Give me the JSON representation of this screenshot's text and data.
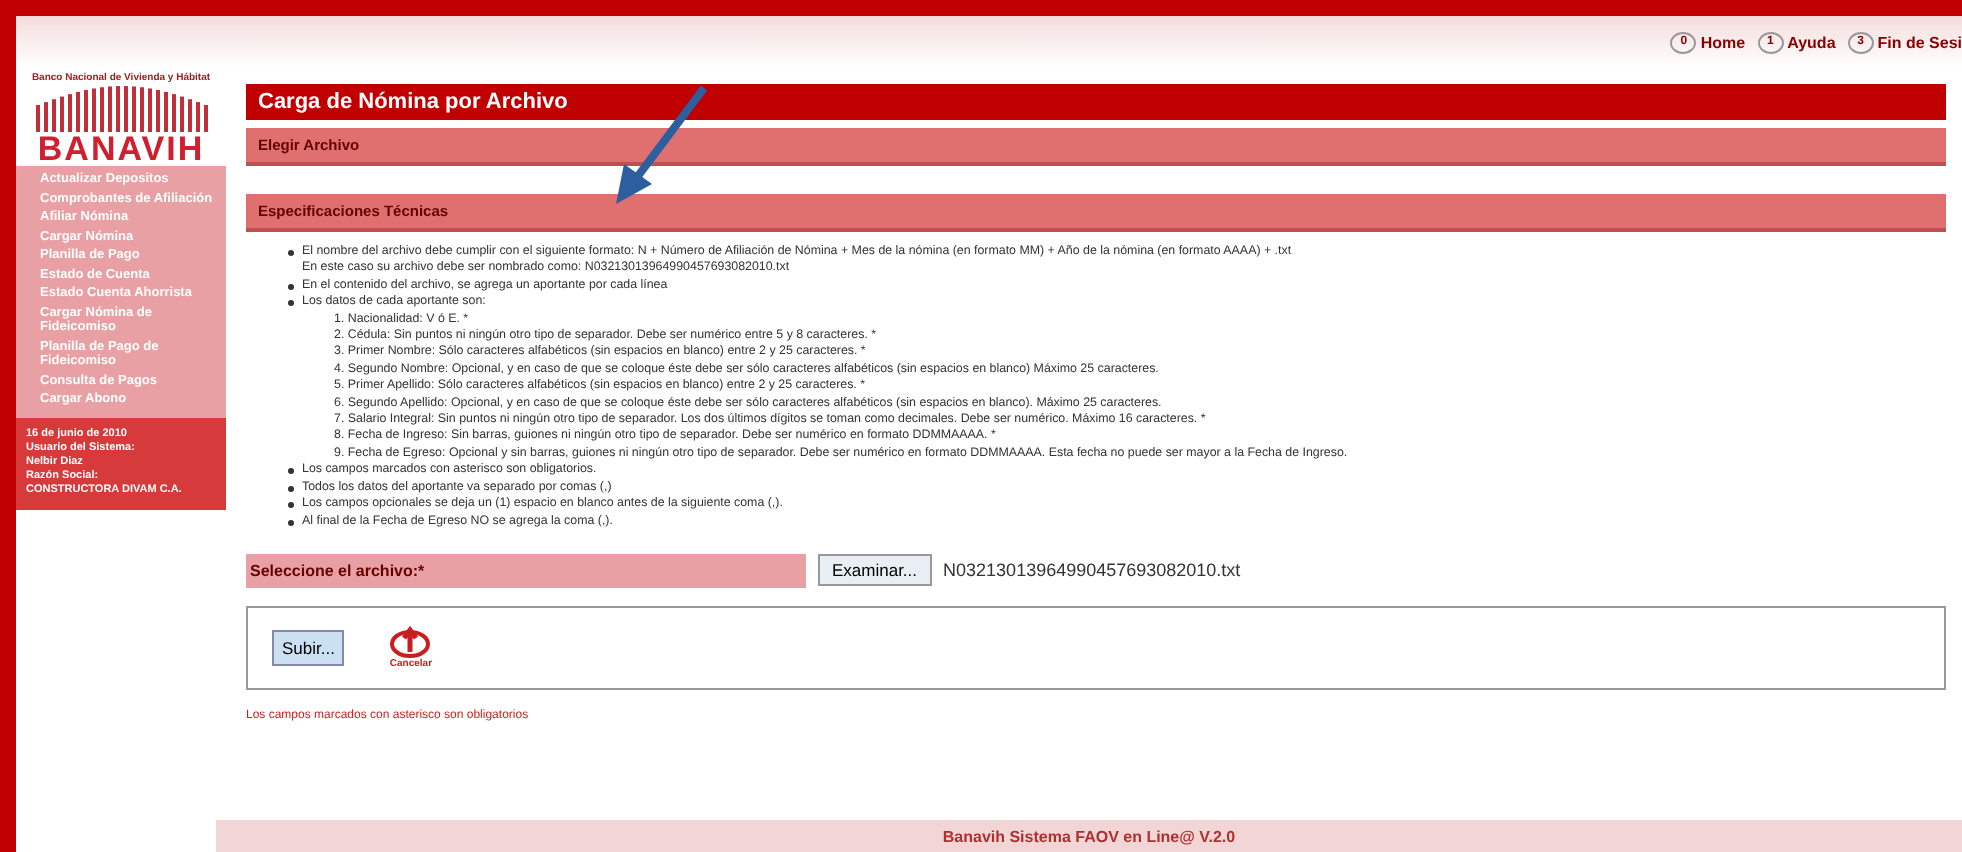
{
  "header": {
    "nav": [
      {
        "number": "0",
        "label": "Home"
      },
      {
        "number": "1",
        "label": "Ayuda"
      },
      {
        "number": "3",
        "label": "Fin de Sesi"
      }
    ]
  },
  "logo": {
    "arc_text": "Banco Nacional de Vivienda y Hábitat",
    "name": "BANAVIH"
  },
  "sidebar": {
    "items": [
      "Actualizar Depositos",
      "Comprobantes de Afiliación",
      "Afiliar Nómina",
      "Cargar Nómina",
      "Planilla de Pago",
      "Estado de Cuenta",
      "Estado Cuenta Ahorrista",
      "Cargar Nómina de Fideicomiso",
      "Planilla de Pago de Fideicomiso",
      "Consulta de Pagos",
      "Cargar Abono"
    ],
    "info": [
      "16 de junio de 2010",
      "Usuario del Sistema:",
      "Nelbir Diaz",
      "Razón Social:",
      "CONSTRUCTORA DIVAM C.A."
    ]
  },
  "page_title": "Carga de Nómina por Archivo",
  "section_title": "Elegir Archivo",
  "specs": {
    "title": "Especificaciones Técnicas",
    "items": [
      {
        "text": "El nombre del archivo debe cumplir con el siguiente formato: N + Número de Afiliación de Nómina + Mes de la nómina (en formato MM) + Año de la nómina (en formato AAAA) + .txt",
        "note": "En este caso su archivo debe ser nombrado como: N03213013964990457693082010.txt"
      },
      {
        "text": "En el contenido del archivo, se agrega un aportante por cada línea"
      },
      {
        "text": "Los datos de cada aportante son:",
        "children": [
          "1. Nacionalidad: V ó E.     *",
          "2. Cédula: Sin puntos ni ningún otro tipo de separador. Debe ser numérico entre 5 y 8 caracteres.     *",
          "3. Primer Nombre: Sólo caracteres alfabéticos (sin espacios en blanco) entre 2 y 25 caracteres.     *",
          "4. Segundo Nombre: Opcional, y en caso de que se coloque éste debe ser sólo caracteres alfabéticos (sin espacios en blanco) Máximo 25 caracteres.",
          "5. Primer Apellido: Sólo caracteres alfabéticos (sin espacios en blanco) entre 2 y 25 caracteres.     *",
          "6. Segundo Apellido: Opcional, y en caso de que se coloque éste debe ser sólo caracteres alfabéticos (sin espacios en blanco). Máximo 25 caracteres.",
          "7. Salario Integral: Sin puntos ni ningún otro tipo de separador. Los dos últimos dígitos se toman como decimales. Debe ser numérico. Máximo 16 caracteres.     *",
          "8. Fecha de Ingreso: Sin barras, guiones ni ningún otro tipo de separador. Debe ser numérico en formato DDMMAAAA.     *",
          "9. Fecha de Egreso: Opcional y sin barras, guiones ni ningún otro tipo de separador. Debe ser numérico en formato DDMMAAAA. Esta fecha no puede ser mayor a la Fecha de Ingreso."
        ]
      },
      {
        "text": "Los campos marcados con asterisco son obligatorios."
      },
      {
        "text": "Todos los datos del aportante va separado por comas (,)"
      },
      {
        "text": "Los campos opcionales se deja un (1) espacio en blanco antes de la siguiente coma (,)."
      },
      {
        "text": "Al final de la Fecha de Egreso NO se agrega la coma (,)."
      }
    ]
  },
  "file": {
    "label": "Seleccione el archivo:*",
    "browse": "Examinar...",
    "value": "N03213013964990457693082010.txt"
  },
  "actions": {
    "submit": "Subir...",
    "cancel": "Cancelar"
  },
  "required_note": "Los campos marcados con asterisco son obligatorios",
  "footer": "Banavih Sistema FAOV en Line@ V.2.0"
}
